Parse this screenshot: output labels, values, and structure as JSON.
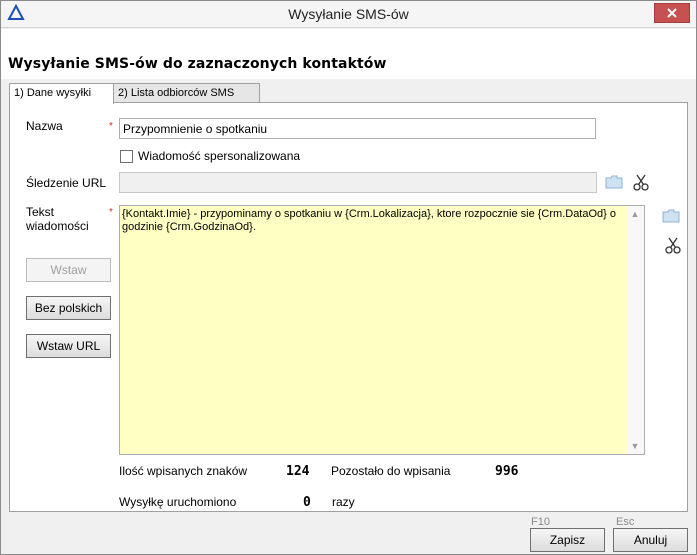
{
  "window": {
    "title": "Wysyłanie SMS-ów",
    "close_label": "x",
    "app_icon": "delta-icon"
  },
  "header": {
    "title": "Wysyłanie SMS-ów do zaznaczonych kontaktów"
  },
  "tabs": [
    {
      "label": "1) Dane wysyłki",
      "active": true
    },
    {
      "label": "2) Lista odbiorców SMS",
      "active": false
    }
  ],
  "form": {
    "name_label": "Nazwa",
    "name_value": "Przypomnienie o spotkaniu",
    "personalized_label": "Wiadomość spersonalizowana",
    "personalized_checked": false,
    "url_tracking_label": "Śledzenie URL",
    "url_tracking_value": "",
    "message_label_line1": "Tekst",
    "message_label_line2": "wiadomości",
    "message_value": "{Kontakt.Imie} - przypominamy o spotkaniu w {Crm.Lokalizacja}, ktore rozpocznie sie {Crm.DataOd} o godzinie {Crm.GodzinaOd}.",
    "required_mark": "*"
  },
  "side_buttons": {
    "insert": "Wstaw",
    "no_polish": "Bez polskich",
    "insert_url": "Wstaw URL"
  },
  "stats": {
    "chars_entered_label": "Ilość wpisanych znaków",
    "chars_entered_value": "124",
    "remaining_label": "Pozostało do wpisania",
    "remaining_value": "996",
    "run_count_label": "Wysyłkę uruchomiono",
    "run_count_value": "0",
    "run_count_suffix": "razy"
  },
  "footer": {
    "save_key": "F10",
    "save_label": "Zapisz",
    "cancel_key": "Esc",
    "cancel_label": "Anuluj"
  },
  "colors": {
    "textarea_bg": "#ffffc4",
    "close_button": "#c75050",
    "app_icon": "#1a4fb5"
  }
}
